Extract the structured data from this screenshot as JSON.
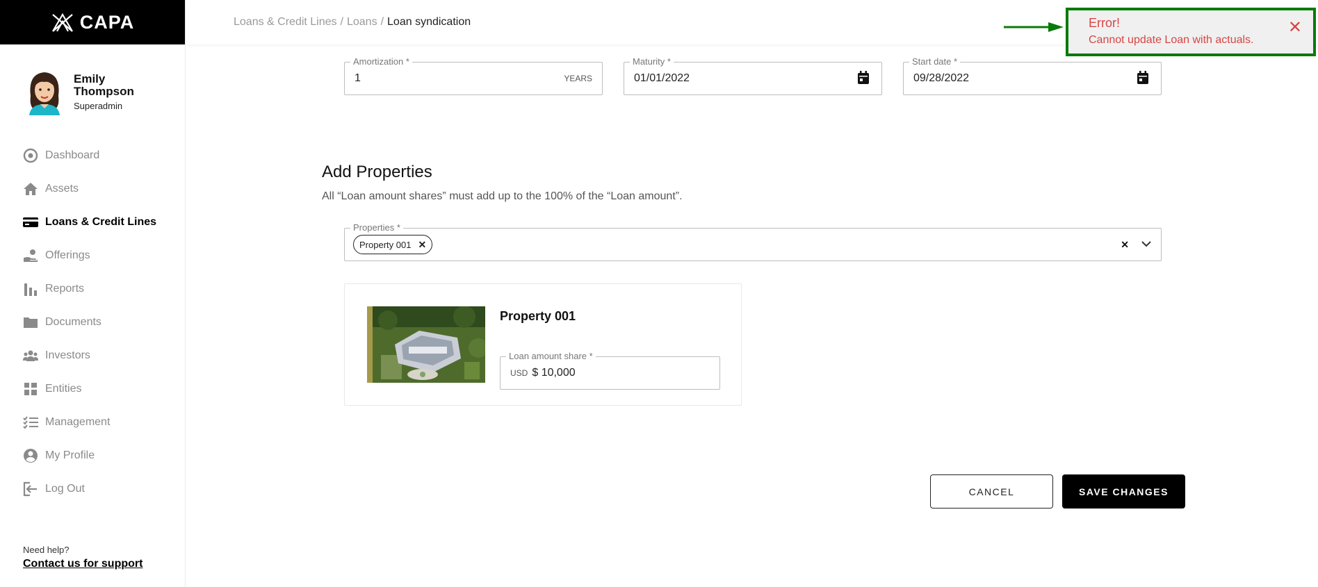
{
  "app": {
    "brand": "CAPA"
  },
  "user": {
    "name_line1": "Emily",
    "name_line2": "Thompson",
    "role": "Superadmin"
  },
  "nav": {
    "items": [
      {
        "label": "Dashboard",
        "icon": "dashboard-icon"
      },
      {
        "label": "Assets",
        "icon": "home-icon"
      },
      {
        "label": "Loans & Credit Lines",
        "icon": "credit-card-icon",
        "active": true
      },
      {
        "label": "Offerings",
        "icon": "hand-coin-icon"
      },
      {
        "label": "Reports",
        "icon": "bar-chart-icon"
      },
      {
        "label": "Documents",
        "icon": "folder-icon"
      },
      {
        "label": "Investors",
        "icon": "users-icon"
      },
      {
        "label": "Entities",
        "icon": "grid-icon"
      },
      {
        "label": "Management",
        "icon": "checklist-icon"
      },
      {
        "label": "My Profile",
        "icon": "user-circle-icon"
      },
      {
        "label": "Log Out",
        "icon": "logout-icon"
      }
    ]
  },
  "help": {
    "text": "Need help?",
    "link": "Contact us for support"
  },
  "breadcrumb": {
    "items": [
      "Loans & Credit Lines",
      "Loans"
    ],
    "current": "Loan syndication"
  },
  "form": {
    "amortization": {
      "label": "Amortization *",
      "value": "1",
      "suffix": "YEARS"
    },
    "maturity": {
      "label": "Maturity *",
      "value": "01/01/2022"
    },
    "start_date": {
      "label": "Start date *",
      "value": "09/28/2022"
    }
  },
  "add_properties": {
    "title": "Add Properties",
    "description": "All “Loan amount shares” must add up to the 100% of the “Loan amount”.",
    "select_label": "Properties *",
    "selected": [
      "Property 001"
    ]
  },
  "property_card": {
    "name": "Property 001",
    "share_label": "Loan amount share *",
    "currency": "USD",
    "value": "$ 10,000"
  },
  "actions": {
    "cancel": "CANCEL",
    "save": "SAVE CHANGES"
  },
  "toast": {
    "title": "Error!",
    "message": "Cannot update Loan with actuals.",
    "close": "✕"
  },
  "colors": {
    "accent": "#000000",
    "error": "#d64545",
    "highlight_border": "#0a7a0a"
  }
}
